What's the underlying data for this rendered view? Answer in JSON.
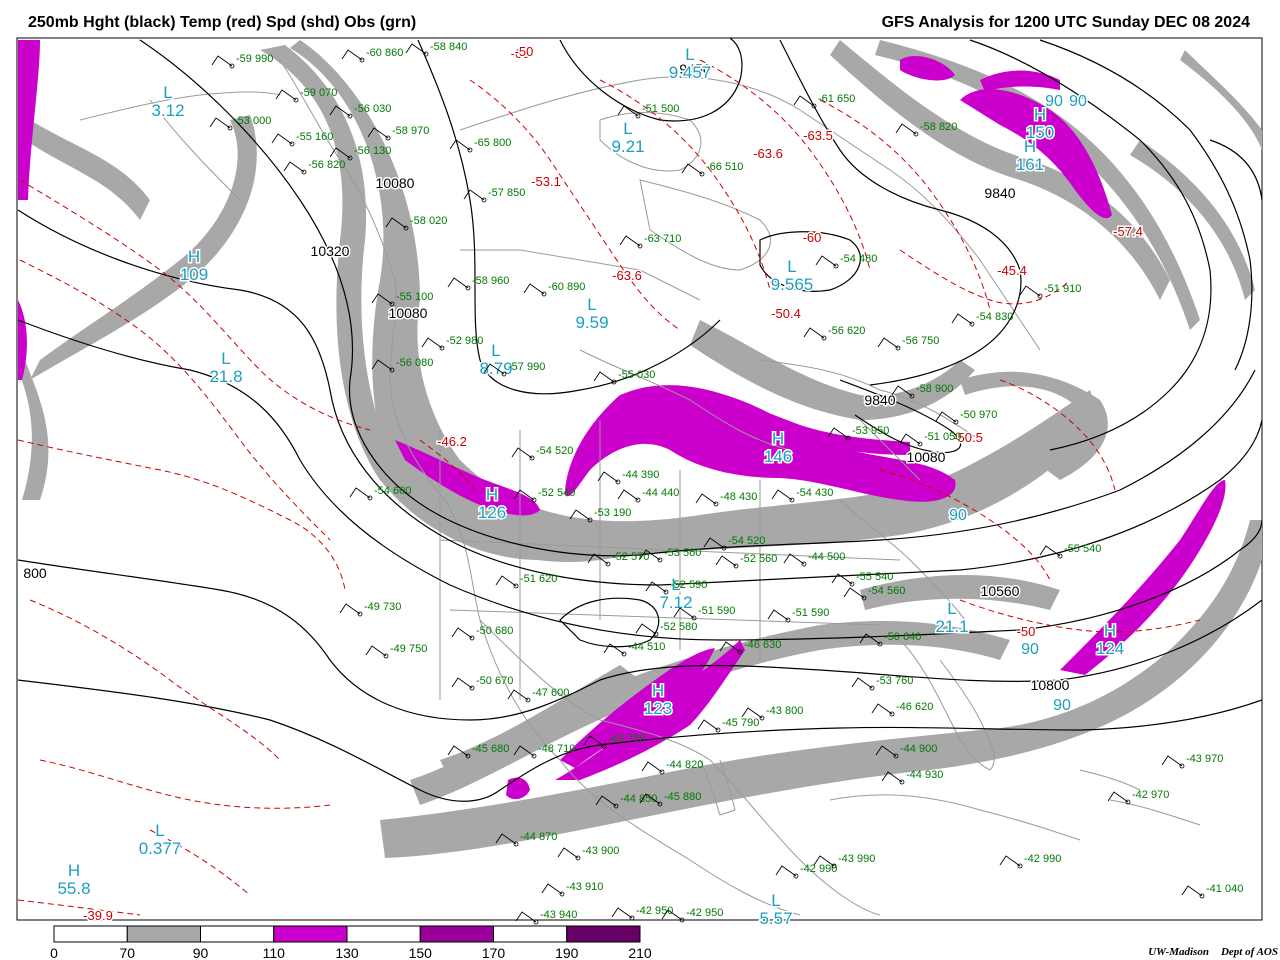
{
  "header": {
    "left_title": "250mb Hght (black) Temp (red) Spd (shd) Obs (grn)",
    "right_title": "GFS Analysis for 1200 UTC Sunday  DEC 08 2024"
  },
  "credit": {
    "org": "UW-Madison",
    "dept": "Dept of AOS"
  },
  "colors": {
    "height_contour": "#000000",
    "temperature_contour": "#cc0000",
    "obs_text": "#007a00",
    "center_label": "#1aa0c0",
    "geography": "#9a9a9a",
    "speed_70_90": "#a8a8a8",
    "speed_110_130": "#cc00cc",
    "speed_150_170": "#990099",
    "speed_190_210": "#660066"
  },
  "legend": {
    "ticks": [
      "0",
      "70",
      "90",
      "110",
      "130",
      "150",
      "170",
      "190",
      "210"
    ],
    "fills": [
      "#ffffff",
      "#a8a8a8",
      "#ffffff",
      "#cc00cc",
      "#ffffff",
      "#990099",
      "#ffffff",
      "#660066"
    ]
  },
  "height_labels": [
    "10080",
    "10320",
    "10080",
    "9840",
    "9840",
    "10080",
    "10560",
    "10800",
    "800",
    "9456"
  ],
  "temp_labels": [
    "-60",
    "-63.6",
    "-63.5",
    "-53.1",
    "-63.6",
    "-60",
    "-50.4",
    "-57.4",
    "-45.4",
    "-46.2",
    "-50.5",
    "-50",
    "-39.9",
    "-50"
  ],
  "centers": [
    {
      "type": "L",
      "value": "3.12"
    },
    {
      "type": "H",
      "value": "109"
    },
    {
      "type": "L",
      "value": "21.8"
    },
    {
      "type": "L",
      "value": "9.21"
    },
    {
      "type": "L",
      "value": "9.59"
    },
    {
      "type": "L",
      "value": "8.79"
    },
    {
      "type": "L",
      "value": "9.457"
    },
    {
      "type": "L",
      "value": "9.565"
    },
    {
      "type": "H",
      "value": "150"
    },
    {
      "type": "H",
      "value": "161"
    },
    {
      "type": "H",
      "value": "146"
    },
    {
      "type": "H",
      "value": "126"
    },
    {
      "type": "L",
      "value": "7.12"
    },
    {
      "type": "L",
      "value": "21.1"
    },
    {
      "type": "H",
      "value": "124"
    },
    {
      "type": "H",
      "value": "123"
    },
    {
      "type": "L",
      "value": "0.377"
    },
    {
      "type": "H",
      "value": "55.8"
    },
    {
      "type": "L",
      "value": "5.57"
    }
  ],
  "speed_labels": [
    "90",
    "90",
    "90",
    "90",
    "90"
  ],
  "obs": [
    "-59 990",
    "-59 070",
    "-53 000",
    "-55 160",
    "-56 820",
    "-58 840",
    "-60 860",
    "-56 030",
    "-58 970",
    "-56 130",
    "-65 800",
    "-57 850",
    "-58 020",
    "-51 500",
    "-63 710",
    "-66 510",
    "-61 650",
    "-58 820",
    "-54 480",
    "-58 960",
    "-60 890",
    "-52 980",
    "-57 990",
    "-55 100",
    "-56 080",
    "-55 030",
    "-56 620",
    "-56 750",
    "-54 830",
    "-51 910",
    "-58 900",
    "-50 970",
    "-53 950",
    "-51 050",
    "-54 520",
    "-52 540",
    "-54 600",
    "-53 190",
    "-44 390",
    "-44 440",
    "-48 430",
    "-52 570",
    "-53 560",
    "-54 520",
    "-52 560",
    "-44 500",
    "-51 620",
    "-52 590",
    "-54 430",
    "-55 540",
    "-55 540",
    "-49 730",
    "-50 680",
    "-51 590",
    "-52 580",
    "-51 590",
    "-46 630",
    "-50 640",
    "-54 560",
    "-49 750",
    "-50 670",
    "-47 600",
    "-44 510",
    "-45 680",
    "-48 710",
    "-43 750",
    "-45 790",
    "-43 800",
    "-53 760",
    "-46 620",
    "-44 900",
    "-44 930",
    "-44 850",
    "-45 880",
    "-44 820",
    "-44 870",
    "-43 900",
    "-43 910",
    "-43 940",
    "-42 950",
    "-42 950",
    "-42 990",
    "-43 990",
    "-42 990",
    "-42 970",
    "-43 970",
    "-41 040"
  ]
}
